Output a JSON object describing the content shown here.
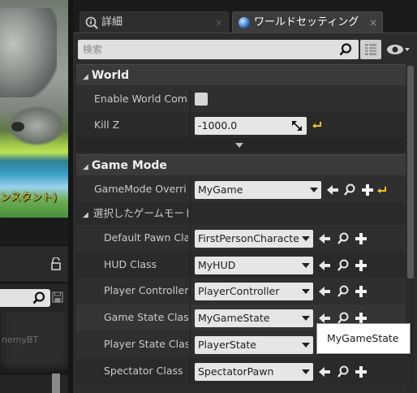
{
  "viewport": {
    "label": "ンスタント)"
  },
  "left_panel": {
    "list_item": "nemyBT"
  },
  "tabs": [
    {
      "label": "詳細",
      "close": "×"
    },
    {
      "label": "ワールドセッティング",
      "close": "×"
    }
  ],
  "search": {
    "placeholder": "検索"
  },
  "sections": {
    "world": {
      "title": "World",
      "enable_world_comp_label": "Enable World Composition",
      "kill_z_label": "Kill Z",
      "kill_z_value": "-1000.0"
    },
    "game_mode": {
      "title": "Game Mode",
      "override_label": "GameMode Override",
      "override_value": "MyGame",
      "selected_label": "選択したゲームモード",
      "rows": [
        {
          "label": "Default Pawn Class",
          "value": "FirstPersonCharacter"
        },
        {
          "label": "HUD Class",
          "value": "MyHUD"
        },
        {
          "label": "Player Controller Class",
          "value": "PlayerController"
        },
        {
          "label": "Game State Class",
          "value": "MyGameState"
        },
        {
          "label": "Player State Class",
          "value": "PlayerState"
        },
        {
          "label": "Spectator Class",
          "value": "SpectatorPawn"
        }
      ]
    }
  },
  "tooltip": {
    "text": "MyGameState"
  },
  "colors": {
    "accent_yellow": "#f2c41a",
    "panel_bg": "#2c2c2c",
    "field_bg": "#e6e6e6"
  },
  "icons": [
    "search-icon",
    "grid-icon",
    "eye-icon",
    "lock-icon",
    "save-icon",
    "reset-arrow-icon",
    "browse-arrow-icon",
    "magnify-icon",
    "plus-icon",
    "drag-icon"
  ]
}
